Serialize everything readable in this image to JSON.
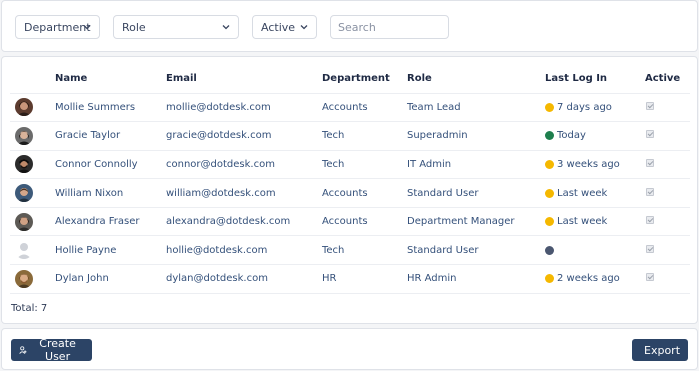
{
  "filters": {
    "department": "Department",
    "role": "Role",
    "active": "Active",
    "search_placeholder": "Search"
  },
  "table": {
    "headers": [
      "",
      "Name",
      "Email",
      "Department",
      "Role",
      "Last Log In",
      "Active"
    ],
    "rows": [
      {
        "name": "Mollie Summers",
        "email": "mollie@dotdesk.com",
        "department": "Accounts",
        "role": "Team Lead",
        "last_login": "7 days ago",
        "status": "yellow",
        "active": true,
        "avatar": "photo"
      },
      {
        "name": "Gracie Taylor",
        "email": "gracie@dotdesk.com",
        "department": "Tech",
        "role": "Superadmin",
        "last_login": "Today",
        "status": "green",
        "active": true,
        "avatar": "photo"
      },
      {
        "name": "Connor Connolly",
        "email": "connor@dotdesk.com",
        "department": "Tech",
        "role": "IT Admin",
        "last_login": "3 weeks ago",
        "status": "yellow",
        "active": true,
        "avatar": "photo"
      },
      {
        "name": "William Nixon",
        "email": "william@dotdesk.com",
        "department": "Accounts",
        "role": "Standard User",
        "last_login": "Last week",
        "status": "yellow",
        "active": true,
        "avatar": "photo"
      },
      {
        "name": "Alexandra Fraser",
        "email": "alexandra@dotdesk.com",
        "department": "Accounts",
        "role": "Department Manager",
        "last_login": "Last week",
        "status": "yellow",
        "active": true,
        "avatar": "photo"
      },
      {
        "name": "Hollie Payne",
        "email": "hollie@dotdesk.com",
        "department": "Tech",
        "role": "Standard User",
        "last_login": "",
        "status": "slate",
        "active": true,
        "avatar": "placeholder"
      },
      {
        "name": "Dylan John",
        "email": "dylan@dotdesk.com",
        "department": "HR",
        "role": "HR Admin",
        "last_login": "2 weeks ago",
        "status": "yellow",
        "active": true,
        "avatar": "photo"
      }
    ],
    "total": "Total: 7"
  },
  "footer": {
    "create_label": "Create User",
    "export_label": "Export"
  },
  "colors": {
    "yellow": "#f5b800",
    "green": "#1e7f4e",
    "slate": "#4b5770",
    "button": "#2c4466",
    "link": "#34507a"
  },
  "icons": {
    "create": "add-user-icon",
    "export": "download-icon",
    "dropdown": "chevron-down-icon"
  }
}
